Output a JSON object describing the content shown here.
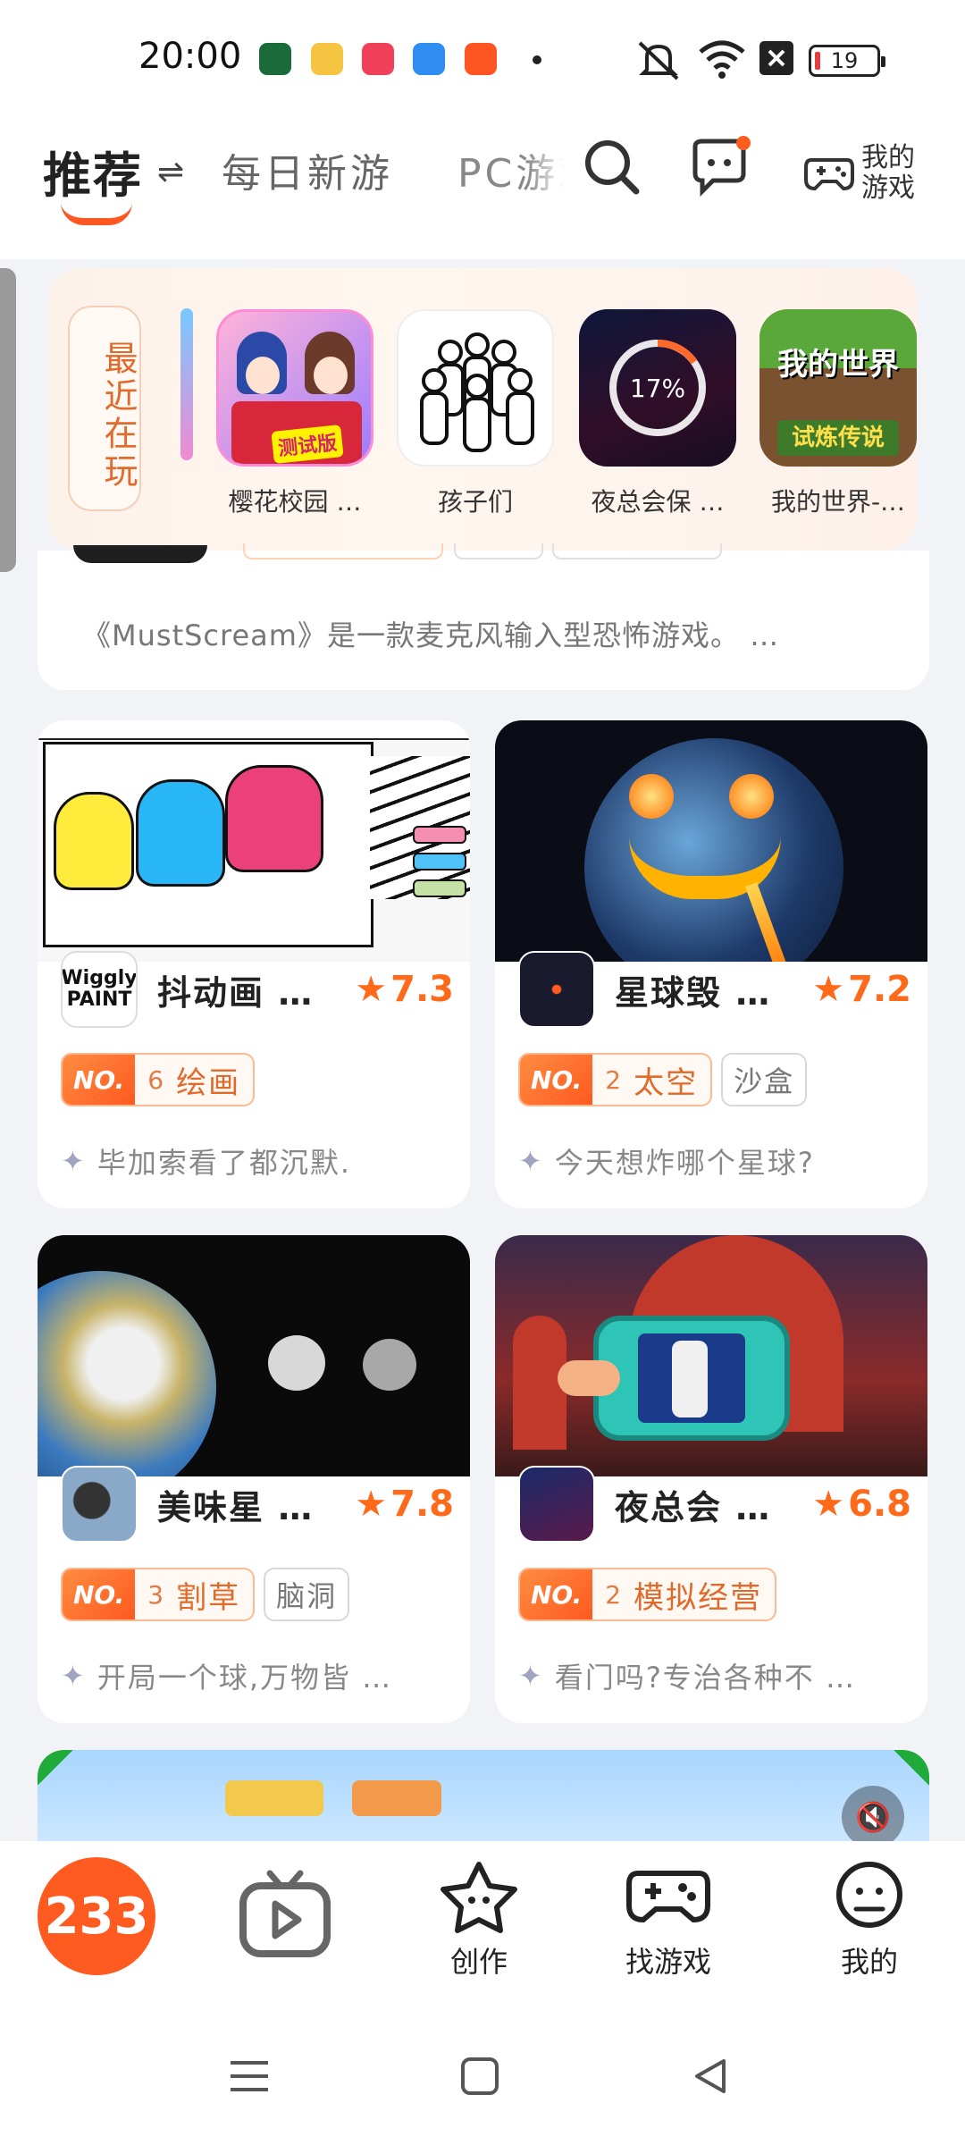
{
  "status_bar": {
    "time": "20:00",
    "battery": "19"
  },
  "top_nav": {
    "active_tab": "推荐",
    "tabs": [
      "每日新游",
      "PC游戏"
    ],
    "my_games_label": "我的游戏"
  },
  "recent": {
    "label": "最近在玩",
    "games": [
      {
        "name": "樱花校园 …",
        "icon_text": "测试版"
      },
      {
        "name": "孩子们"
      },
      {
        "name": "夜总会保 …",
        "progress_text": "17%",
        "progress": 0.17
      },
      {
        "name": "我的世界-…",
        "icon_text_top": "我的世界",
        "icon_text_bottom": "试炼传说"
      }
    ]
  },
  "partial_card": {
    "description": "《MustScream》是一款麦克风输入型恐怖游戏。 …"
  },
  "cards": [
    {
      "name": "抖动画 …",
      "rating": "7.3",
      "rank_no": "NO.",
      "rank_num": "6",
      "rank_cat": "绘画",
      "tags": [],
      "desc": "毕加索看了都沉默.",
      "icon_text": "Wiggly PAINT"
    },
    {
      "name": "星球毁 …",
      "rating": "7.2",
      "rank_no": "NO.",
      "rank_num": "2",
      "rank_cat": "太空",
      "tags": [
        "沙盒"
      ],
      "desc": "今天想炸哪个星球?"
    },
    {
      "name": "美味星 …",
      "rating": "7.8",
      "rank_no": "NO.",
      "rank_num": "3",
      "rank_cat": "割草",
      "tags": [
        "脑洞"
      ],
      "desc": "开局一个球,万物皆 …"
    },
    {
      "name": "夜总会 …",
      "rating": "6.8",
      "rank_no": "NO.",
      "rank_num": "2",
      "rank_cat": "模拟经营",
      "tags": [],
      "desc": "看门吗?专治各种不 …"
    }
  ],
  "bottom_nav": {
    "home_logo": "233",
    "items": [
      "创作",
      "找游戏",
      "我的"
    ]
  },
  "colors": {
    "accent": "#ff5a1f",
    "rating": "#ff6a1a"
  }
}
